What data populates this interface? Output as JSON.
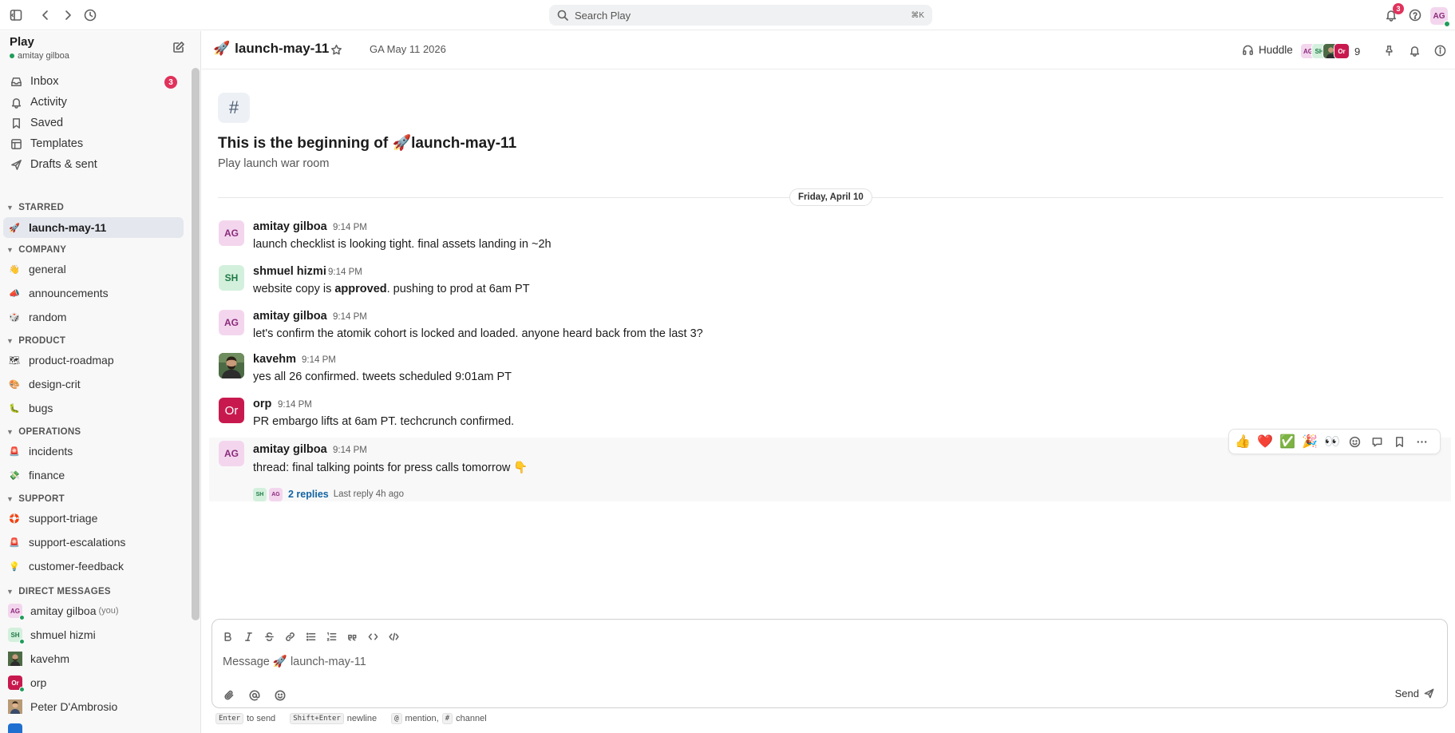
{
  "search": {
    "placeholder": "Search Play",
    "shortcut": "⌘K"
  },
  "topbar": {
    "notifications_count": "3",
    "avatar_initials": "AG"
  },
  "workspace": {
    "name": "Play",
    "user": "amitay gilboa"
  },
  "nav": [
    {
      "label": "Inbox",
      "icon": "inbox-icon",
      "badge": "3"
    },
    {
      "label": "Activity",
      "icon": "bell-icon"
    },
    {
      "label": "Saved",
      "icon": "bookmark-icon"
    },
    {
      "label": "Templates",
      "icon": "template-icon"
    },
    {
      "label": "Drafts & sent",
      "icon": "send-icon"
    }
  ],
  "sections": {
    "starred": "STARRED",
    "company": "COMPANY",
    "product": "PRODUCT",
    "operations": "OPERATIONS",
    "support": "SUPPORT",
    "dms": "DIRECT MESSAGES"
  },
  "channels": {
    "starred": [
      {
        "emoji": "🚀",
        "name": "launch-may-11"
      }
    ],
    "company": [
      {
        "emoji": "👋",
        "name": "general"
      },
      {
        "emoji": "📣",
        "name": "announcements"
      },
      {
        "emoji": "🎲",
        "name": "random"
      }
    ],
    "product": [
      {
        "emoji": "🗺",
        "name": "product-roadmap"
      },
      {
        "emoji": "🎨",
        "name": "design-crit"
      },
      {
        "emoji": "🐛",
        "name": "bugs"
      }
    ],
    "operations": [
      {
        "emoji": "🚨",
        "name": "incidents"
      },
      {
        "emoji": "💸",
        "name": "finance"
      }
    ],
    "support": [
      {
        "emoji": "🛟",
        "name": "support-triage"
      },
      {
        "emoji": "🚨",
        "name": "support-escalations"
      },
      {
        "emoji": "💡",
        "name": "customer-feedback"
      }
    ]
  },
  "dms": [
    {
      "initials": "AG",
      "name": "amitay gilboa",
      "suffix": "(you)"
    },
    {
      "initials": "SH",
      "name": "shmuel hizmi",
      "suffix": ""
    },
    {
      "initials": "",
      "name": "kavehm",
      "suffix": ""
    },
    {
      "initials": "Or",
      "name": "orp",
      "suffix": ""
    },
    {
      "initials": "",
      "name": "Peter D'Ambrosio",
      "suffix": ""
    }
  ],
  "header": {
    "channel_emoji": "🚀",
    "channel_name": "launch-may-11",
    "topic": "GA May 11 2026",
    "huddle_label": "Huddle",
    "member_initials": [
      "AG",
      "SH",
      "",
      "Or"
    ],
    "member_count": "9"
  },
  "intro": {
    "hash": "#",
    "title": "This is the beginning of 🚀launch-may-11",
    "subtitle": "Play launch war room"
  },
  "date_divider": "Friday, April 10",
  "messages": [
    {
      "initials": "AG",
      "author": "amitay gilboa",
      "time": "9:14 PM",
      "text": "launch checklist is looking tight. final assets landing in ~2h"
    },
    {
      "initials": "SH",
      "author": "shmuel hizmi",
      "time": "9:14 PM",
      "text_before": "website copy is ",
      "text_bold": "approved",
      "text_after": ". pushing to prod at 6am PT"
    },
    {
      "initials": "AG",
      "author": "amitay gilboa",
      "time": "9:14 PM",
      "text": "let's confirm the atomik cohort is locked and loaded. anyone heard back from the last 3?"
    },
    {
      "initials": "",
      "author": "kavehm",
      "time": "9:14 PM",
      "text": "yes all 26 confirmed. tweets scheduled 9:01am PT"
    },
    {
      "initials": "Or",
      "author": "orp",
      "time": "9:14 PM",
      "text": "PR embargo lifts at 6am PT. techcrunch confirmed."
    },
    {
      "initials": "AG",
      "author": "amitay gilboa",
      "time": "9:14 PM",
      "text": "thread: final talking points for press calls tomorrow 👇",
      "thread": {
        "avatars": [
          "SH",
          "AG"
        ],
        "replies": "2 replies",
        "last_reply": "Last reply 4h ago"
      }
    }
  ],
  "reactions": [
    "👍",
    "❤️",
    "✅",
    "🎉",
    "👀"
  ],
  "composer": {
    "placeholder": "Message 🚀 launch-may-11",
    "send_label": "Send"
  },
  "hints": {
    "enter_key": "Enter",
    "enter_text": "to send",
    "shift_key": "Shift+Enter",
    "shift_text": "newline",
    "at_key": "@",
    "at_text": "mention,",
    "hash_key": "#",
    "hash_text": "channel"
  }
}
